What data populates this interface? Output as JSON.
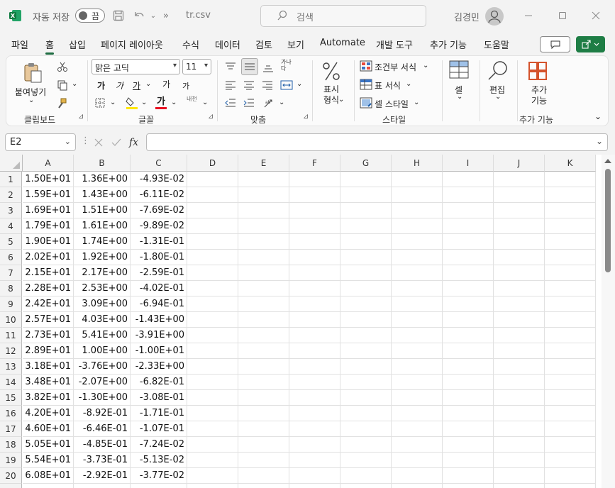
{
  "titlebar": {
    "autosave_label": "자동 저장",
    "autosave_state": "끔",
    "filename": "tr.csv",
    "search_placeholder": "검색",
    "user_name": "김경민"
  },
  "menu": {
    "tabs": [
      "파일",
      "홈",
      "삽입",
      "페이지 레이아웃",
      "수식",
      "데이터",
      "검토",
      "보기",
      "Automate",
      "개발 도구",
      "추가 기능",
      "도움말"
    ],
    "active": "홈"
  },
  "ribbon": {
    "clipboard": {
      "paste_label": "붙여넣기",
      "group_label": "클립보드"
    },
    "font": {
      "name": "맑은 고딕",
      "size": "11",
      "group_label": "글꼴",
      "bold": "가",
      "italic": "가",
      "underline": "가",
      "grow": "가",
      "shrink": "가",
      "color_glyph": "가",
      "phonetic": "내천"
    },
    "alignment": {
      "group_label": "맞춤",
      "wrap": "가나다"
    },
    "number": {
      "label": "표시 형식"
    },
    "styles": {
      "group_label": "스타일",
      "conditional": "조건부 서식",
      "table": "표 서식",
      "cell": "셀 스타일"
    },
    "cells": {
      "label": "셀"
    },
    "editing": {
      "label": "편집"
    },
    "addins": {
      "label": "추가 기능",
      "group_label": "추가 기능"
    }
  },
  "formula_bar": {
    "name_box": "E2",
    "formula": ""
  },
  "sheet": {
    "columns": [
      "A",
      "B",
      "C",
      "D",
      "E",
      "F",
      "G",
      "H",
      "I",
      "J",
      "K"
    ],
    "rows": [
      [
        "1.50E+01",
        "1.36E+00",
        "-4.93E-02"
      ],
      [
        "1.59E+01",
        "1.43E+00",
        "-6.11E-02"
      ],
      [
        "1.69E+01",
        "1.51E+00",
        "-7.69E-02"
      ],
      [
        "1.79E+01",
        "1.61E+00",
        "-9.89E-02"
      ],
      [
        "1.90E+01",
        "1.74E+00",
        "-1.31E-01"
      ],
      [
        "2.02E+01",
        "1.92E+00",
        "-1.80E-01"
      ],
      [
        "2.15E+01",
        "2.17E+00",
        "-2.59E-01"
      ],
      [
        "2.28E+01",
        "2.53E+00",
        "-4.02E-01"
      ],
      [
        "2.42E+01",
        "3.09E+00",
        "-6.94E-01"
      ],
      [
        "2.57E+01",
        "4.03E+00",
        "-1.43E+00"
      ],
      [
        "2.73E+01",
        "5.41E+00",
        "-3.91E+00"
      ],
      [
        "2.89E+01",
        "1.00E+00",
        "-1.00E+01"
      ],
      [
        "3.18E+01",
        "-3.76E+00",
        "-2.33E+00"
      ],
      [
        "3.48E+01",
        "-2.07E+00",
        "-6.82E-01"
      ],
      [
        "3.82E+01",
        "-1.30E+00",
        "-3.08E-01"
      ],
      [
        "4.20E+01",
        "-8.92E-01",
        "-1.71E-01"
      ],
      [
        "4.60E+01",
        "-6.46E-01",
        "-1.07E-01"
      ],
      [
        "5.05E+01",
        "-4.85E-01",
        "-7.24E-02"
      ],
      [
        "5.54E+01",
        "-3.73E-01",
        "-5.13E-02"
      ],
      [
        "6.08E+01",
        "-2.92E-01",
        "-3.77E-02"
      ]
    ]
  },
  "colors": {
    "excel_green": "#1e7d45",
    "accent_tab": "#1e6c41"
  }
}
